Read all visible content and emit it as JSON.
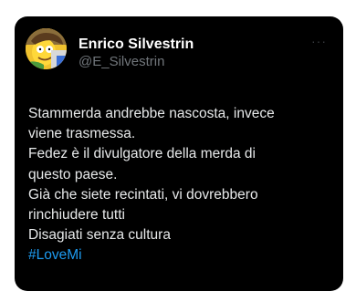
{
  "tweet": {
    "author": {
      "display_name": "Enrico Silvestrin",
      "handle": "@E_Silvestrin",
      "avatar_icon": "cartoon-avatar-icon"
    },
    "more_icon": "more-options-icon",
    "more_glyph": "···",
    "text_lines": [
      "Stammerda andrebbe nascosta, invece",
      "viene trasmessa.",
      "Fedez è il divulgatore della merda di",
      "questo paese.",
      "Già che siete recintati, vi dovrebbero",
      "rinchiudere tutti",
      "Disagiati senza cultura"
    ],
    "hashtag": "#LoveMi",
    "colors": {
      "background": "#000000",
      "text": "#e7e9ea",
      "secondary": "#71767b",
      "link": "#1d9bf0"
    }
  }
}
